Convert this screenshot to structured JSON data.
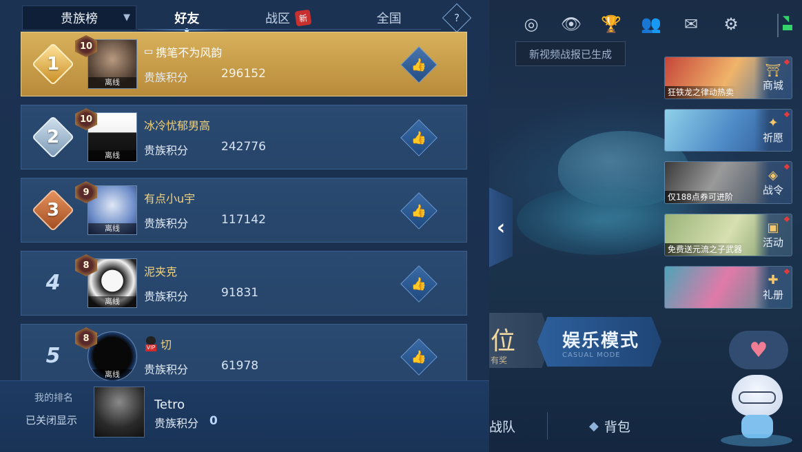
{
  "tabs": {
    "dropdown_label": "贵族榜",
    "items": [
      {
        "label": "好友",
        "active": true
      },
      {
        "label": "战区",
        "badge": "新"
      },
      {
        "label": "全国"
      }
    ],
    "help": "?"
  },
  "leaderboard": [
    {
      "rank": "1",
      "level": "10",
      "name": "携笔不为风韵",
      "score_label": "贵族积分",
      "score": "296152",
      "status": "离线"
    },
    {
      "rank": "2",
      "level": "10",
      "name": "冰冷忧郁男高",
      "score_label": "贵族积分",
      "score": "242776",
      "status": "离线"
    },
    {
      "rank": "3",
      "level": "9",
      "name": "有点小u宇",
      "score_label": "贵族积分",
      "score": "117142",
      "status": "离线"
    },
    {
      "rank": "4",
      "level": "8",
      "name": "泥夹克",
      "score_label": "贵族积分",
      "score": "91831",
      "status": "离线"
    },
    {
      "rank": "5",
      "level": "8",
      "name": "切",
      "vip_tag": "VIP",
      "score_label": "贵族积分",
      "score": "61978",
      "status": "离线"
    }
  ],
  "my_rank": {
    "label": "我的排名",
    "status": "已关闭显示",
    "name": "Tetro",
    "score_label": "贵族积分",
    "score": "0"
  },
  "scene": {
    "tooltip": "新视频战报已生成",
    "cards": [
      {
        "caption": "狂铁龙之律动热卖",
        "label": "商城",
        "icon": "shop-icon"
      },
      {
        "caption": "",
        "label": "祈愿",
        "icon": "wish-icon"
      },
      {
        "caption": "仅188点券可进阶",
        "label": "战令",
        "icon": "pass-icon"
      },
      {
        "caption": "免费送元流之子武器",
        "label": "活动",
        "icon": "event-icon"
      },
      {
        "caption": "",
        "label": "礼册",
        "icon": "gift-book-icon"
      }
    ],
    "mode_rank": {
      "big": "位",
      "small": "有奖"
    },
    "mode_casual": {
      "title": "娱乐模式",
      "sub": "CASUAL MODE"
    },
    "bottom": {
      "team": "战队",
      "bag": "背包"
    },
    "accent_colors": {
      "gold_row": "#c9a04a",
      "row_blue": "#284770",
      "alert_red": "#e23b3b"
    }
  }
}
